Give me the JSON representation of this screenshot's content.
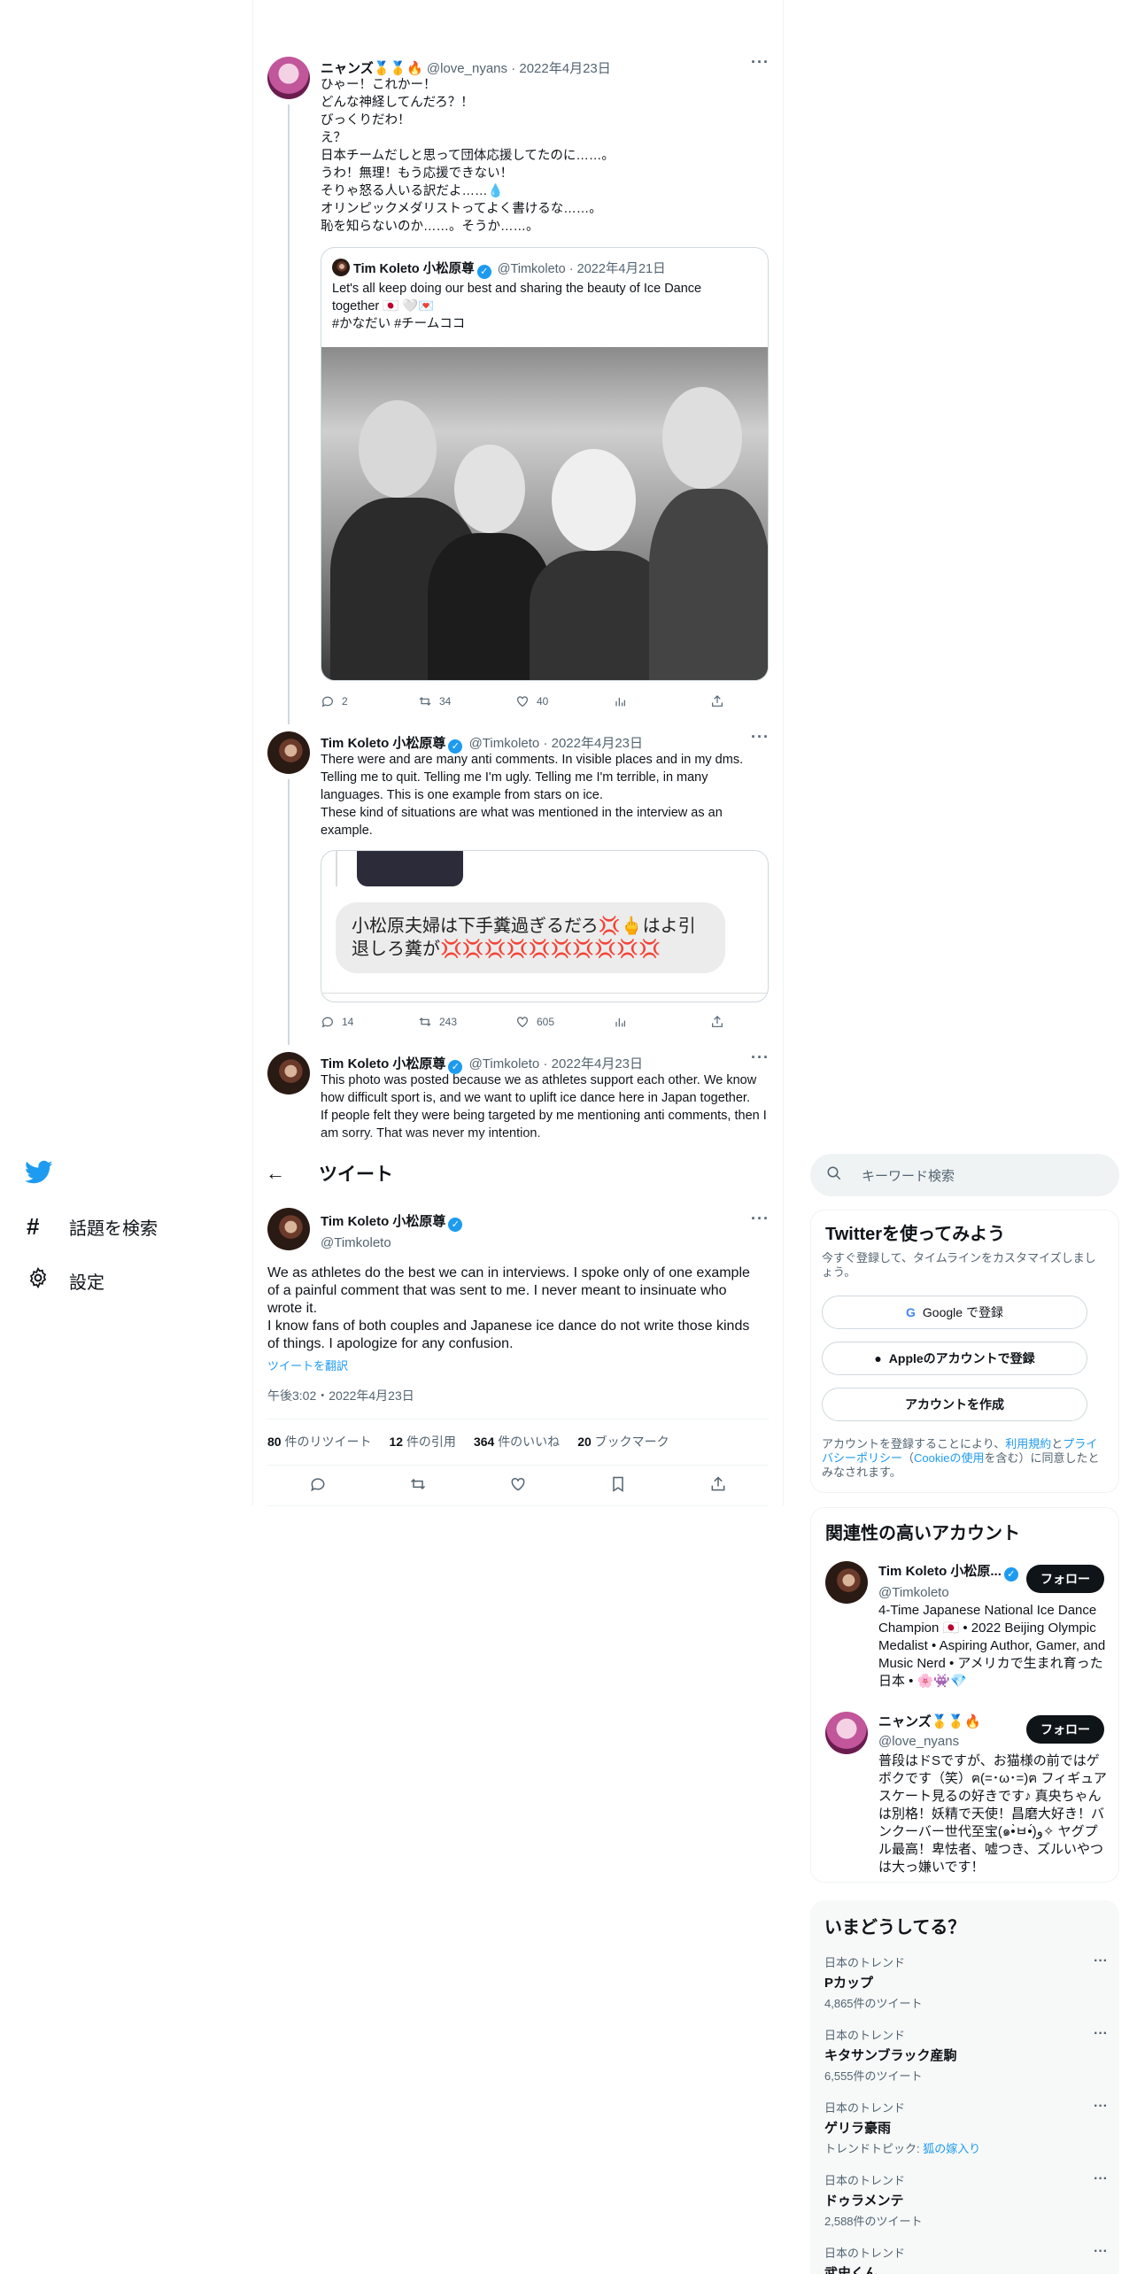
{
  "thread": {
    "tweet1": {
      "name": "ニャンズ🥇🥇🔥",
      "handle": "@love_nyans",
      "date": "2022年4月23日",
      "text": "ひゃー！これかー！\nどんな神経してんだろ？！\nびっくりだわ！\nえ？\n日本チームだしと思って団体応援してたのに……。\nうわ！無理！もう応援できない！\nそりゃ怒る人いる訳だよ……💧\nオリンピックメダリストってよく書けるな……。\n恥を知らないのか……。そうか……。",
      "quote": {
        "name": "Tim Koleto 小松原尊",
        "handle": "@Timkoleto",
        "date": "2022年4月21日",
        "text": "Let's all keep doing our best and sharing the beauty of Ice Dance together 🇯🇵 🤍💌\n#かなだい #チームココ"
      },
      "replies": "2",
      "retweets": "34",
      "likes": "40"
    },
    "tweet2": {
      "name": "Tim Koleto 小松原尊",
      "handle": "@Timkoleto",
      "date": "2022年4月23日",
      "text": "There were and are many anti comments. In visible places and in my dms. Telling me to quit. Telling me I'm ugly. Telling me I'm terrible, in many languages. This is one example from stars on ice.\nThese kind of situations are what was mentioned in the interview as an example.",
      "dm_message": "小松原夫婦は下手糞過ぎるだろ💢🖕はよ引退しろ糞が💢💢💢💢💢💢💢💢💢💢",
      "replies": "14",
      "retweets": "243",
      "likes": "605"
    },
    "tweet3": {
      "name": "Tim Koleto 小松原尊",
      "handle": "@Timkoleto",
      "date": "2022年4月23日",
      "text": "This photo was posted because we as athletes support each other. We know how difficult sport is, and we want to uplift ice dance here in Japan together.\nIf people felt they were being targeted by me mentioning anti comments, then I am sorry. That was never my intention."
    }
  },
  "nav": {
    "explore": "話題を検索",
    "settings": "設定"
  },
  "main": {
    "header_title": "ツイート",
    "author_name": "Tim Koleto 小松原尊",
    "author_handle": "@Timkoleto",
    "text": "We as athletes do the best we can in interviews. I spoke only of one example of a painful comment that was sent to me. I never meant to insinuate who wrote it.\nI know fans of both couples and Japanese ice dance do not write those kinds of things. I apologize for any confusion.",
    "translate": "ツイートを翻訳",
    "timestamp": "午後3:02・2022年4月23日",
    "stats": {
      "retweets_n": "80",
      "retweets_l": "件のリツイート",
      "quotes_n": "12",
      "quotes_l": "件の引用",
      "likes_n": "364",
      "likes_l": "件のいいね",
      "bookmarks_n": "20",
      "bookmarks_l": "ブックマーク"
    }
  },
  "sidebar": {
    "search_placeholder": "キーワード検索",
    "signup": {
      "title": "Twitterを使ってみよう",
      "subtitle": "今すぐ登録して、タイムラインをカスタマイズしましょう。",
      "google": "Google で登録",
      "apple": "Appleのアカウントで登録",
      "create": "アカウントを作成",
      "legal_1": "アカウントを登録することにより、",
      "legal_terms": "利用規約",
      "legal_2": "と",
      "legal_privacy": "プライバシーポリシー",
      "legal_3": "（",
      "legal_cookie": "Cookieの使用",
      "legal_4": "を含む）に同意したとみなされます。"
    },
    "related": {
      "title": "関連性の高いアカウント",
      "accounts": [
        {
          "name": "Tim Koleto 小松原...",
          "handle": "@Timkoleto",
          "follow": "フォロー",
          "bio": "4-Time Japanese National Ice Dance Champion 🇯🇵 • 2022 Beijing Olympic Medalist • Aspiring Author, Gamer, and Music Nerd • アメリカで生まれ育った日本 • 🌸👾💎"
        },
        {
          "name": "ニャンズ🥇🥇🔥",
          "handle": "@love_nyans",
          "follow": "フォロー",
          "bio": "普段はドSですが、お猫様の前ではゲボクです（笑）ฅ(=･ω･=)ฅ フィギュアスケート見るの好きです♪ 真央ちゃんは別格！妖精で天使！昌磨大好き！バンクーバー世代至宝(๑•̀ㅂ•́)و✧ ヤグプル最高！卑怯者、嘘つき、ズルいやつは大っ嫌いです！"
        }
      ]
    },
    "trends": {
      "title": "いまどうしてる？",
      "items": [
        {
          "context": "日本のトレンド",
          "name": "Pカップ",
          "count": "4,865件のツイート"
        },
        {
          "context": "日本のトレンド",
          "name": "キタサンブラック産駒",
          "count": "6,555件のツイート"
        },
        {
          "context": "日本のトレンド",
          "name": "ゲリラ豪雨",
          "count": "トレンドトピック: ",
          "topic": "狐の嫁入り"
        },
        {
          "context": "日本のトレンド",
          "name": "ドゥラメンテ",
          "count": "2,588件のツイート"
        },
        {
          "context": "日本のトレンド",
          "name": "武史くん",
          "count": ""
        }
      ]
    }
  },
  "colors": {
    "accent": "#1d9bf0",
    "text": "#0f1419",
    "muted": "#536471"
  }
}
